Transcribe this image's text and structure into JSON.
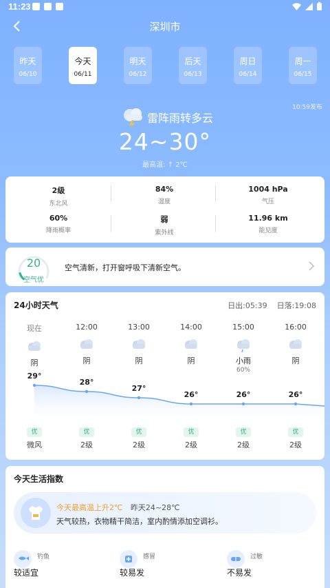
{
  "status": {
    "time": "11:23"
  },
  "nav": {
    "city": "深圳市"
  },
  "days": [
    {
      "name": "昨天",
      "date": "06/10",
      "active": false
    },
    {
      "name": "今天",
      "date": "06/11",
      "active": true
    },
    {
      "name": "明天",
      "date": "06/12",
      "active": false
    },
    {
      "name": "后天",
      "date": "06/13",
      "active": false
    },
    {
      "name": "周日",
      "date": "06/14",
      "active": false
    },
    {
      "name": "周一",
      "date": "06/15",
      "active": false
    }
  ],
  "summary": {
    "publish_time": "10:59发布",
    "condition": "雷阵雨转多云",
    "temp_range": "24~30°",
    "max_note": "最高温: ↑ 2℃",
    "icon": "thunderstorm-cloud-icon"
  },
  "stats": [
    {
      "value": "2级",
      "label": "东北风"
    },
    {
      "value": "84%",
      "label": "湿度"
    },
    {
      "value": "1004 hPa",
      "label": "气压"
    },
    {
      "value": "60%",
      "label": "降雨概率"
    },
    {
      "value": "弱",
      "label": "紫外线"
    },
    {
      "value": "11.96 km",
      "label": "能见度"
    }
  ],
  "air": {
    "aqi": "20",
    "aqi_fraction": 0.1,
    "label": "空气优",
    "tip": "空气清新，打开窗呼吸下清新空气。",
    "color": "#33b38a"
  },
  "hourly": {
    "title": "24小时天气",
    "sunrise": "日出:05:39",
    "sunset": "日落:19:08",
    "hours": [
      {
        "time": "现在",
        "cond": "阴",
        "pop": "",
        "temp": "29°",
        "aq": "优",
        "wind": "微风",
        "icon": "cloudy-icon"
      },
      {
        "time": "12:00",
        "cond": "阴",
        "pop": "",
        "temp": "28°",
        "aq": "优",
        "wind": "2级",
        "icon": "cloudy-icon"
      },
      {
        "time": "13:00",
        "cond": "阴",
        "pop": "",
        "temp": "27°",
        "aq": "优",
        "wind": "2级",
        "icon": "cloudy-icon"
      },
      {
        "time": "14:00",
        "cond": "阴",
        "pop": "",
        "temp": "26°",
        "aq": "优",
        "wind": "2级",
        "icon": "cloudy-icon"
      },
      {
        "time": "15:00",
        "cond": "小雨",
        "pop": "60%",
        "temp": "26°",
        "aq": "优",
        "wind": "2级",
        "icon": "light-rain-icon"
      },
      {
        "time": "16:00",
        "cond": "阴",
        "pop": "",
        "temp": "26°",
        "aq": "优",
        "wind": "2级",
        "icon": "cloudy-icon"
      }
    ],
    "temps": [
      29,
      28,
      27,
      26,
      26,
      26
    ]
  },
  "life": {
    "title": "今天生活指数",
    "rise_note": "今天最高温上升2℃",
    "yesterday": "昨天24~28℃",
    "desc": "天气较热，衣物精干简洁，室内酌情添加空调衫。",
    "items": [
      {
        "name": "钓鱼",
        "value": "较适宜",
        "icon": "fish-icon"
      },
      {
        "name": "感冒",
        "value": "较易发",
        "icon": "medicine-icon"
      },
      {
        "name": "过敏",
        "value": "不易发",
        "icon": "pill-icon"
      }
    ]
  }
}
